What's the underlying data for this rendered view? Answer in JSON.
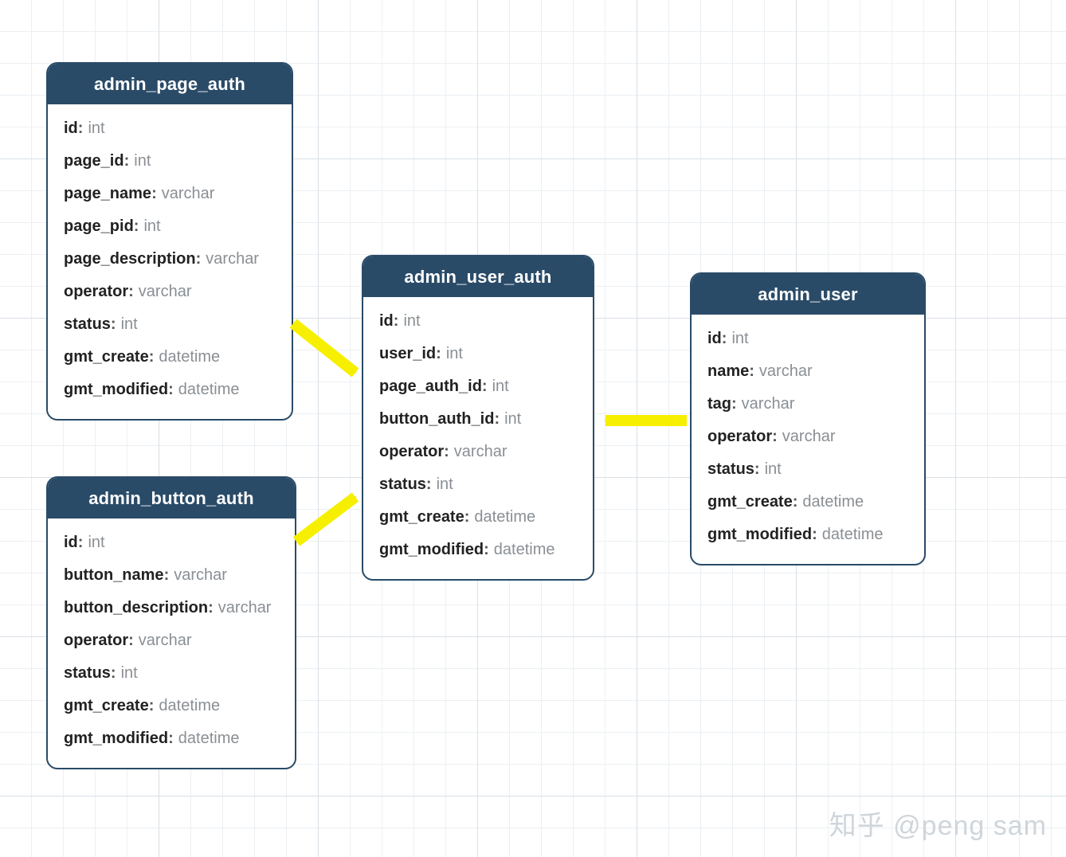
{
  "colors": {
    "header_bg": "#2a4b68",
    "border": "#2a4b68",
    "type_text": "#8a8f94",
    "arrow": "#f7ef00"
  },
  "watermark": "知乎 @peng sam",
  "entities": {
    "admin_page_auth": {
      "title": "admin_page_auth",
      "fields": [
        {
          "name": "id",
          "type": "int"
        },
        {
          "name": "page_id",
          "type": "int"
        },
        {
          "name": "page_name",
          "type": "varchar"
        },
        {
          "name": "page_pid",
          "type": "int"
        },
        {
          "name": "page_description",
          "type": "varchar"
        },
        {
          "name": "operator",
          "type": "varchar"
        },
        {
          "name": "status",
          "type": "int"
        },
        {
          "name": "gmt_create",
          "type": "datetime"
        },
        {
          "name": "gmt_modified",
          "type": "datetime"
        }
      ]
    },
    "admin_button_auth": {
      "title": "admin_button_auth",
      "fields": [
        {
          "name": "id",
          "type": "int"
        },
        {
          "name": "button_name",
          "type": "varchar"
        },
        {
          "name": "button_description",
          "type": "varchar"
        },
        {
          "name": "operator",
          "type": "varchar"
        },
        {
          "name": "status",
          "type": "int"
        },
        {
          "name": "gmt_create",
          "type": "datetime"
        },
        {
          "name": "gmt_modified",
          "type": "datetime"
        }
      ]
    },
    "admin_user_auth": {
      "title": "admin_user_auth",
      "fields": [
        {
          "name": "id",
          "type": "int"
        },
        {
          "name": "user_id",
          "type": "int"
        },
        {
          "name": "page_auth_id",
          "type": "int"
        },
        {
          "name": "button_auth_id",
          "type": "int"
        },
        {
          "name": "operator",
          "type": "varchar"
        },
        {
          "name": "status",
          "type": "int"
        },
        {
          "name": "gmt_create",
          "type": "datetime"
        },
        {
          "name": "gmt_modified",
          "type": "datetime"
        }
      ]
    },
    "admin_user": {
      "title": "admin_user",
      "fields": [
        {
          "name": "id",
          "type": "int"
        },
        {
          "name": "name",
          "type": "varchar"
        },
        {
          "name": "tag",
          "type": "varchar"
        },
        {
          "name": "operator",
          "type": "varchar"
        },
        {
          "name": "status",
          "type": "int"
        },
        {
          "name": "gmt_create",
          "type": "datetime"
        },
        {
          "name": "gmt_modified",
          "type": "datetime"
        }
      ]
    }
  },
  "arrows": [
    {
      "from": "admin_page_auth",
      "to": "admin_user_auth"
    },
    {
      "from": "admin_button_auth",
      "to": "admin_user_auth"
    },
    {
      "from": "admin_user",
      "to": "admin_user_auth"
    }
  ]
}
